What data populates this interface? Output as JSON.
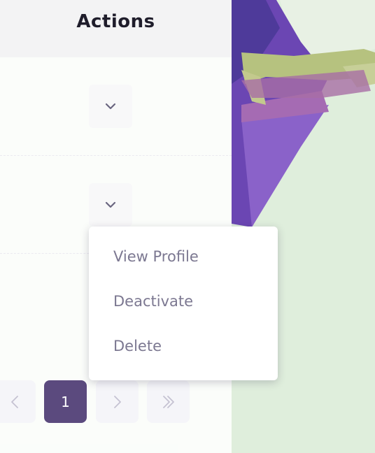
{
  "table": {
    "header_title": "Actions",
    "rows": [
      {
        "action_icon": "chevron-down-icon"
      },
      {
        "action_icon": "chevron-down-icon"
      }
    ]
  },
  "dropdown_menu": {
    "items": [
      {
        "label": "View Profile"
      },
      {
        "label": "Deactivate"
      },
      {
        "label": "Delete"
      }
    ]
  },
  "pagination": {
    "current_page": "1",
    "icons": [
      "chevron-left-icon",
      "chevron-right-icon",
      "double-chevron-right-icon"
    ]
  },
  "colors": {
    "accent": "#5b4a7e",
    "menu_text": "#7c7891",
    "header_text": "#1f1d2b"
  }
}
